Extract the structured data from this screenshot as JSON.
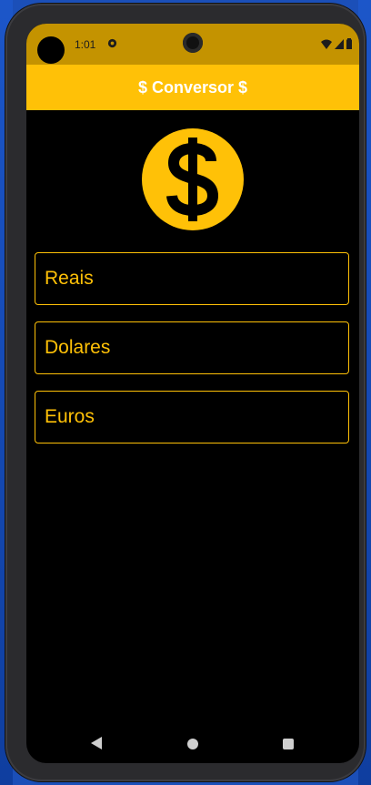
{
  "status_bar": {
    "time": "1:01",
    "icons": [
      "sync-icon",
      "wifi-icon",
      "signal-icon",
      "battery-icon"
    ]
  },
  "app_bar": {
    "title": "$ Conversor $"
  },
  "logo": {
    "icon": "dollar-icon",
    "color": "#ffc107"
  },
  "fields": [
    {
      "label": "Reais"
    },
    {
      "label": "Dolares"
    },
    {
      "label": "Euros"
    }
  ],
  "nav_bar": {
    "icons": [
      "back-icon",
      "home-icon",
      "recents-icon"
    ]
  },
  "colors": {
    "accent": "#ffc107",
    "status_bar": "#c49300",
    "background": "#000000"
  }
}
